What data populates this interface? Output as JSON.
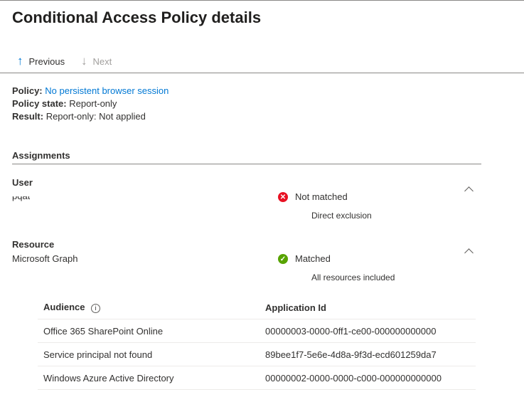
{
  "header": {
    "title": "Conditional Access Policy details"
  },
  "nav": {
    "previous": "Previous",
    "next": "Next"
  },
  "policy": {
    "policy_label": "Policy:",
    "policy_value": "No persistent browser session",
    "state_label": "Policy state:",
    "state_value": "Report-only",
    "result_label": "Result:",
    "result_value": "Report-only: Not applied"
  },
  "assignments": {
    "title": "Assignments",
    "user": {
      "label": "User",
      "value": "pqat",
      "status": "Not matched",
      "detail": "Direct exclusion",
      "status_color": "#e81123"
    },
    "resource": {
      "label": "Resource",
      "value": "Microsoft Graph",
      "status": "Matched",
      "detail": "All resources included",
      "status_color": "#57a300"
    }
  },
  "table": {
    "headers": [
      "Audience",
      "Application Id"
    ],
    "rows": [
      [
        "Office 365 SharePoint Online",
        "00000003-0000-0ff1-ce00-000000000000"
      ],
      [
        "Service principal not found",
        "89bee1f7-5e6e-4d8a-9f3d-ecd601259da7"
      ],
      [
        "Windows Azure Active Directory",
        "00000002-0000-0000-c000-000000000000"
      ]
    ]
  }
}
